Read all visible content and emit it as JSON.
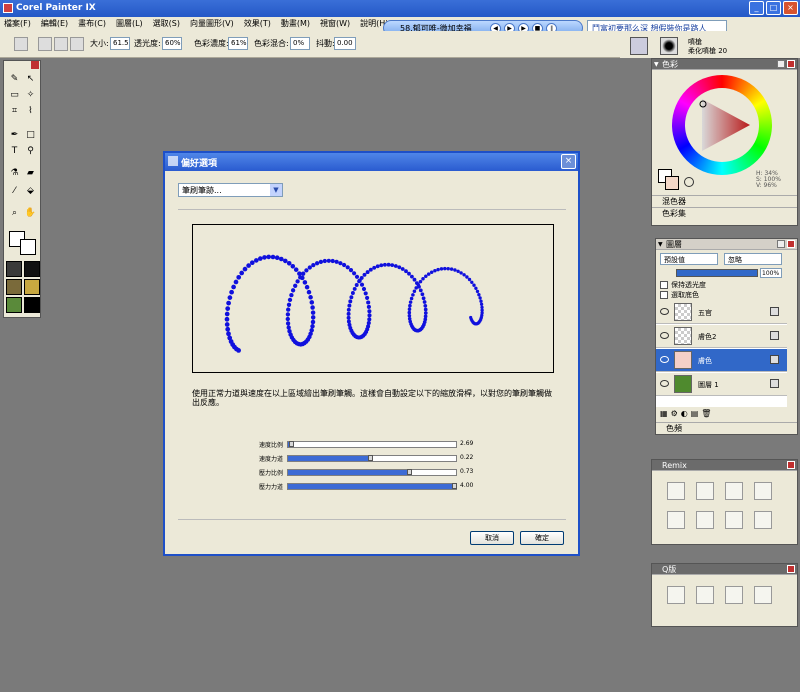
{
  "app": {
    "title": "Corel Painter IX"
  },
  "menu": [
    "檔案(F)",
    "編輯(E)",
    "畫布(C)",
    "圖層(L)",
    "選取(S)",
    "向量圖形(V)",
    "效果(T)",
    "動畫(M)",
    "視窗(W)",
    "說明(H)"
  ],
  "toolbar": {
    "size_label": "大小:",
    "size_value": "61.5",
    "opacity_label": "透光度:",
    "opacity_value": "60%",
    "resat_label": "色彩濃度:",
    "resat_value": "61%",
    "bleed_label": "色彩混合:",
    "bleed_value": "0%",
    "jitter_label": "抖動:",
    "jitter_value": "0.00"
  },
  "media": {
    "song": "58.郁可唯-微加幸福",
    "box_text": "鬥富初要那么深   想假裝你是路人"
  },
  "brush_top": {
    "line1": "噴槍",
    "line2": "柔化噴槍 20"
  },
  "dialog": {
    "title": "偏好選項",
    "select_value": "筆刷筆跡...",
    "description": "使用正常力道與速度在以上區域繪出筆刷筆觸。這樣會自動設定以下的縮放滑桿，以對您的筆刷筆觸做出反應。",
    "sliders": [
      {
        "label": "速度比例",
        "value": "2.69",
        "level": 0.03
      },
      {
        "label": "速度力道",
        "value": "0.22",
        "level": 0.5
      },
      {
        "label": "壓力比例",
        "value": "0.73",
        "level": 0.73
      },
      {
        "label": "壓力力道",
        "value": "4.00",
        "level": 1.0
      }
    ],
    "cancel_label": "取消",
    "ok_label": "確定"
  },
  "color_panel": {
    "title": "色彩",
    "hsv": {
      "h": "H: 34%",
      "s": "S: 100%",
      "v": "V: 96%"
    },
    "mixer_label": "混色器",
    "color_set_label": "色彩集"
  },
  "layers_panel": {
    "title": "圖層",
    "composite_method": "預設值",
    "composite_depth": "忽略",
    "opacity_value": "100%",
    "preserve_label": "保持透光度",
    "pick_up_label": "選取底色",
    "layers": [
      {
        "name": "五官",
        "selected": false
      },
      {
        "name": "膚色2",
        "selected": false
      },
      {
        "name": "膚色",
        "selected": true
      },
      {
        "name": "圖層 1",
        "selected": false
      }
    ],
    "channels_label": "色頻"
  },
  "remix_panel": {
    "title": "Remix"
  },
  "q_panel": {
    "title": "Q版"
  },
  "colors": {
    "accent": "#3168c8",
    "dialog_title": "#2a5bd0",
    "stroke": "#1010dd",
    "canvas": "#7a7a7a"
  }
}
